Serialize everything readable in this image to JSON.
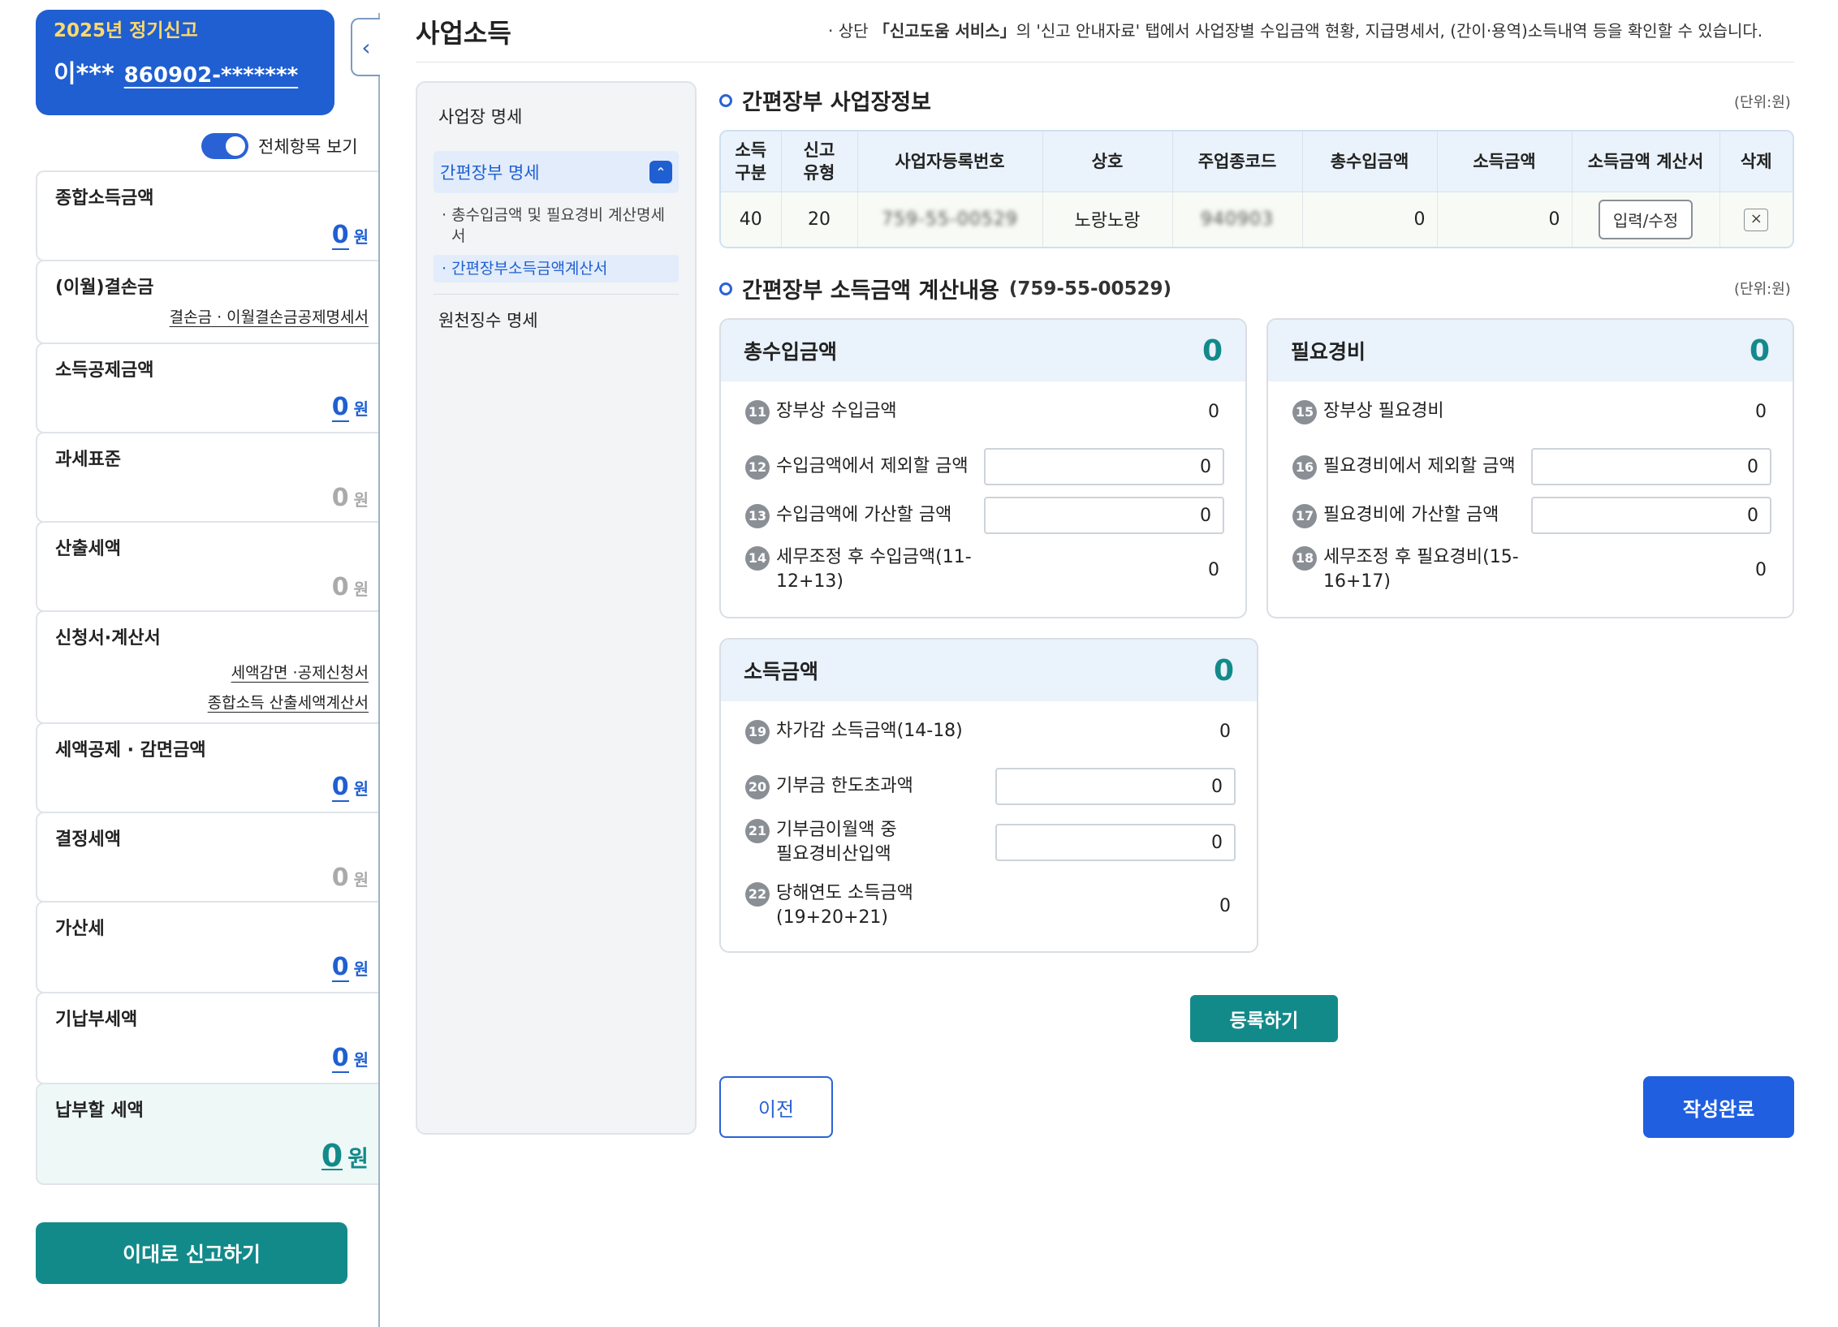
{
  "sidebar": {
    "filing_label": "2025년 정기신고",
    "user_name": "이***",
    "user_ssn": "860902-*******",
    "toggle_label": "전체항목 보기",
    "collapse_icon": "‹",
    "items": [
      {
        "label": "종합소득금액",
        "value": "0",
        "unit": "원"
      },
      {
        "label": "(이월)결손금",
        "links": [
          "결손금 · 이월결손금공제명세서"
        ]
      },
      {
        "label": "소득공제금액",
        "value": "0",
        "unit": "원"
      },
      {
        "label": "과세표준",
        "value": "0",
        "unit": "원"
      },
      {
        "label": "산출세액",
        "value": "0",
        "unit": "원"
      },
      {
        "label": "신청서·계산서",
        "links": [
          "세액감면 ·공제신청서",
          "종합소득 산출세액계산서"
        ]
      },
      {
        "label": "세액공제 · 감면금액",
        "value": "0",
        "unit": "원"
      },
      {
        "label": "결정세액",
        "value": "0",
        "unit": "원"
      },
      {
        "label": "가산세",
        "value": "0",
        "unit": "원"
      },
      {
        "label": "기납부세액",
        "value": "0",
        "unit": "원"
      },
      {
        "label": "납부할 세액",
        "value": "0",
        "unit": "원"
      }
    ],
    "report_button": "이대로 신고하기"
  },
  "main": {
    "title": "사업소득",
    "notice_prefix": "· 상단 ",
    "notice_bold": "「신고도움 서비스」",
    "notice_suffix": "의 '신고 안내자료' 탭에서 사업장별 수입금액 현황, 지급명세서, (간이·용역)소득내역 등을 확인할 수 있습니다."
  },
  "subnav": {
    "item1": "사업장 명세",
    "item2": "간편장부 명세",
    "item2_sub1": "· 총수입금액 및 필요경비 계산명세서",
    "item2_sub2": "· 간편장부소득금액계산서",
    "item3": "원천징수 명세",
    "chevron_icon": "⌃"
  },
  "biz_section": {
    "title": "간편장부 사업장정보",
    "unit_note": "(단위:원)",
    "headers": [
      "소득\n구분",
      "신고\n유형",
      "사업자등록번호",
      "상호",
      "주업종코드",
      "총수입금액",
      "소득금액",
      "소득금액 계산서",
      "삭제"
    ],
    "row": {
      "income_type": "40",
      "report_type": "20",
      "reg_no": "759-55-00529",
      "company": "노랑노랑",
      "industry_code": "940903",
      "total_income": "0",
      "income_amount": "0",
      "edit_label": "입력/수정",
      "delete_icon": "×"
    }
  },
  "calc_section": {
    "title": "간편장부 소득금액 계산내용",
    "reg_no": "(759-55-00529)",
    "unit_note": "(단위:원)",
    "revenue_card": {
      "title": "총수입금액",
      "total": "0",
      "rows": [
        {
          "no": "11",
          "label": "장부상 수입금액",
          "value": "0"
        },
        {
          "no": "12",
          "label": "수입금액에서 제외할 금액",
          "value": "0"
        },
        {
          "no": "13",
          "label": "수입금액에 가산할 금액",
          "value": "0"
        },
        {
          "no": "14",
          "label": "세무조정 후 수입금액(11-\n12+13)",
          "value": "0"
        }
      ]
    },
    "expense_card": {
      "title": "필요경비",
      "total": "0",
      "rows": [
        {
          "no": "15",
          "label": "장부상 필요경비",
          "value": "0"
        },
        {
          "no": "16",
          "label": "필요경비에서 제외할 금액",
          "value": "0"
        },
        {
          "no": "17",
          "label": "필요경비에 가산할 금액",
          "value": "0"
        },
        {
          "no": "18",
          "label": "세무조정 후 필요경비(15-\n16+17)",
          "value": "0"
        }
      ]
    },
    "income_card": {
      "title": "소득금액",
      "total": "0",
      "rows": [
        {
          "no": "19",
          "label": "차가감 소득금액(14-18)",
          "value": "0"
        },
        {
          "no": "20",
          "label": "기부금 한도초과액",
          "value": "0"
        },
        {
          "no": "21",
          "label": "기부금이월액 중\n필요경비산입액",
          "value": "0"
        },
        {
          "no": "22",
          "label": "당해연도 소득금액\n(19+20+21)",
          "value": "0"
        }
      ]
    }
  },
  "buttons": {
    "register": "등록하기",
    "prev": "이전",
    "done": "작성완료"
  },
  "colors": {
    "primary_blue": "#1f5fd1",
    "teal": "#138a8a"
  }
}
